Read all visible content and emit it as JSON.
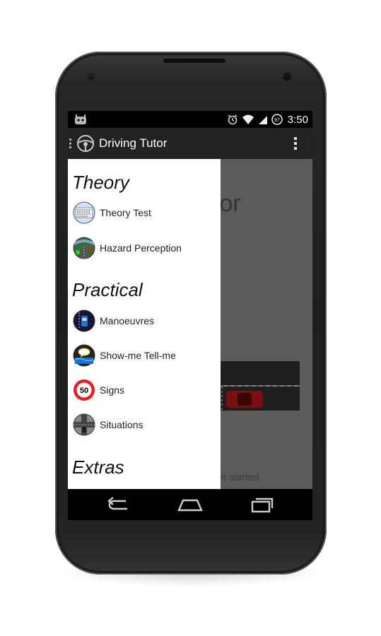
{
  "status": {
    "time": "3:50",
    "battery": "87"
  },
  "actionbar": {
    "title": "Driving Tutor"
  },
  "background": {
    "title_fragment": "utor",
    "hint_fragment": "et started"
  },
  "drawer": {
    "sections": [
      {
        "title": "Theory",
        "items": [
          {
            "label": "Theory Test",
            "icon": "theory-test-icon"
          },
          {
            "label": "Hazard Perception",
            "icon": "hazard-perception-icon"
          }
        ]
      },
      {
        "title": "Practical",
        "items": [
          {
            "label": "Manoeuvres",
            "icon": "manoeuvres-icon"
          },
          {
            "label": "Show-me Tell-me",
            "icon": "show-me-tell-me-icon"
          },
          {
            "label": "Signs",
            "icon": "speed-sign-icon",
            "sign_text": "50"
          },
          {
            "label": "Situations",
            "icon": "situations-icon"
          }
        ]
      },
      {
        "title": "Extras",
        "items": []
      }
    ]
  },
  "colors": {
    "actionbar": "#222222",
    "overlay": "#5b5b5b",
    "drawer": "#ffffff",
    "sign_red": "#e02020"
  }
}
